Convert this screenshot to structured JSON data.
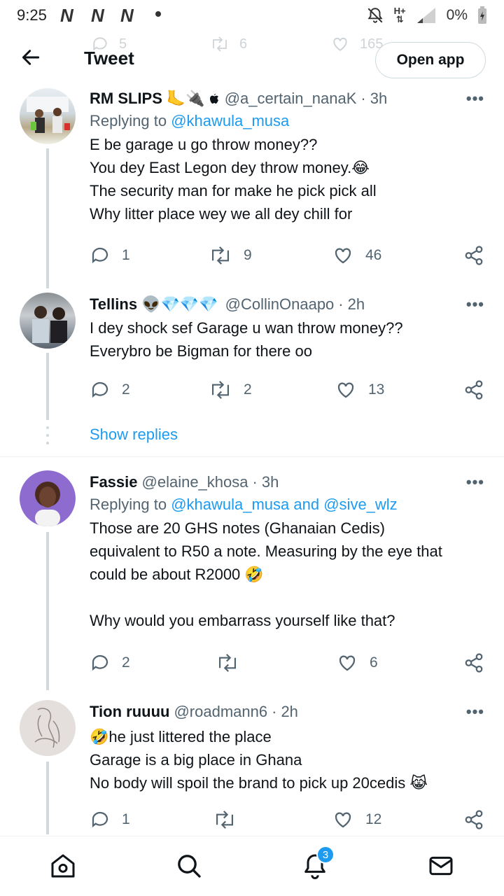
{
  "status_bar": {
    "time": "9:25",
    "network_glyphs": [
      "N",
      "N",
      "N"
    ],
    "battery_percent": "0%",
    "network_type": "H+"
  },
  "header": {
    "title": "Tweet",
    "open_app_label": "Open app",
    "ghost_counts": {
      "replies": "5",
      "retweets": "6",
      "likes": "165"
    }
  },
  "tweets": [
    {
      "name": "RM SLIPS",
      "emojis": "🦶🔌",
      "handle": "@a_certain_nanaK",
      "time": "3h",
      "replying_prefix": "Replying to ",
      "replying_to": "@khawula_musa",
      "replying_and": "",
      "replying_to_2": "",
      "text": "E be garage u go throw money??\nYou dey East Legon dey throw money.😂\nThe security man for make he pick pick all\nWhy litter place wey we all dey chill for",
      "replies": "1",
      "retweets": "9",
      "likes": "46"
    },
    {
      "name": "Tellins",
      "emojis": "👽💎💎💎",
      "handle": "@CollinOnaapo",
      "time": "2h",
      "text": "I dey shock sef Garage u wan throw money??\nEverybro be Bigman for there oo",
      "replies": "2",
      "retweets": "2",
      "likes": "13"
    },
    {
      "name": "Fassie",
      "emojis": "",
      "handle": "@elaine_khosa",
      "time": "3h",
      "replying_prefix": "Replying to ",
      "replying_to": "@khawula_musa",
      "replying_and": " and ",
      "replying_to_2": "@sive_wlz",
      "text": "Those are 20 GHS notes  (Ghanaian Cedis)\nequivalent to R50 a note. Measuring by the eye that\ncould be about R2000 🤣\n\nWhy would you embarrass yourself like that?",
      "replies": "2",
      "retweets": "",
      "likes": "6"
    },
    {
      "name": "Tion ruuuu",
      "emojis": "",
      "handle": "@roadmann6",
      "time": "2h",
      "text": "🤣he just littered the place\nGarage is a big place in Ghana\nNo body will spoil the brand to pick up 20cedis 😹",
      "replies": "1",
      "retweets": "",
      "likes": "12"
    }
  ],
  "show_replies_label": "Show replies",
  "bottom_nav": {
    "notifications_badge": "3",
    "icons": [
      "home-icon",
      "search-icon",
      "bell-icon",
      "mail-icon"
    ]
  },
  "colors": {
    "accent": "#1d9bf0",
    "text": "#0f1419",
    "muted": "#536471",
    "line": "#cfd9de"
  }
}
